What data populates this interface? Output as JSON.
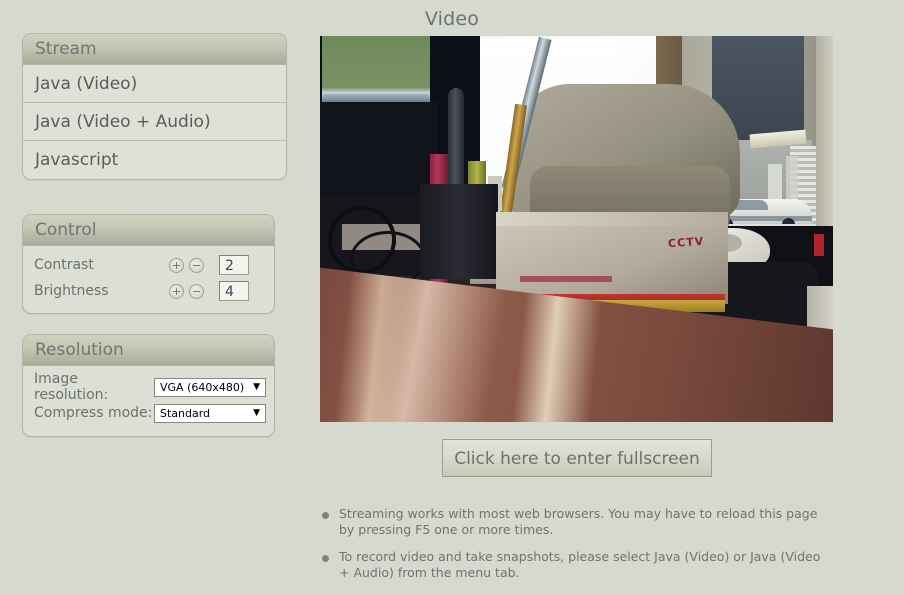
{
  "page": {
    "title": "Video",
    "background_color": "#d6d9cd",
    "text_color": "#6e7373"
  },
  "stream_panel": {
    "header": "Stream",
    "items": [
      {
        "label": "Java (Video)"
      },
      {
        "label": "Java (Video + Audio)"
      },
      {
        "label": "Javascript"
      }
    ]
  },
  "control_panel": {
    "header": "Control",
    "rows": [
      {
        "label": "Contrast",
        "increase": "+",
        "decrease": "−",
        "value": "2"
      },
      {
        "label": "Brightness",
        "increase": "+",
        "decrease": "−",
        "value": "4"
      }
    ]
  },
  "resolution_panel": {
    "header": "Resolution",
    "rows": [
      {
        "label": "Image resolution:",
        "value": "VGA (640x480)",
        "arrow": "▼"
      },
      {
        "label": "Compress mode:",
        "value": "Standard",
        "arrow": "▼"
      }
    ]
  },
  "video": {
    "alt": "live-camera-stream",
    "cctv_label": "CCTV"
  },
  "fullscreen": {
    "label": "Click here to enter fullscreen"
  },
  "notes": [
    {
      "text": "Streaming works with most web browsers. You may have to reload this page by pressing F5 one or more times."
    },
    {
      "text": "To record video and take snapshots, please select Java (Video) or Java (Video + Audio) from the menu tab."
    }
  ]
}
